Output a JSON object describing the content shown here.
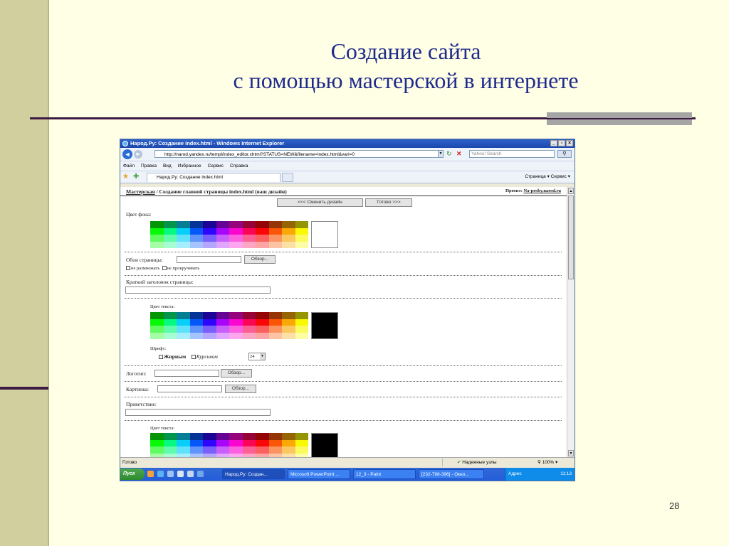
{
  "slide": {
    "title_line1": "Создание сайта",
    "title_line2": "с помощью мастерской в интернете",
    "page_number": "28"
  },
  "browser": {
    "window_title": "Народ.Ру: Создание index.html - Windows Internet Explorer",
    "address": "http://narod.yandex.ru/templ/index_editor.xhtml?STATUS=NEW&filename=index.html&vari=0",
    "search_placeholder": "Yahoo! Search",
    "menu": [
      "Файл",
      "Правка",
      "Вид",
      "Избранное",
      "Сервис",
      "Справка"
    ],
    "tab_title": "Народ.Ру: Создание index.html",
    "command_bar": "Страница ▾  Сервис ▾",
    "status_text": "Готово",
    "zone_text": "Надежные узлы",
    "zoom_text": "100%"
  },
  "page": {
    "breadcrumb_link": "Мастерская",
    "breadcrumb_rest": " / Создание главной страницы index.html (ваш дизайн)",
    "project_label": "Проект: ",
    "project_value": "Na-proby.narod.ru",
    "change_design_button": "<<< Сменить дизайн",
    "done_button": "Готово >>>",
    "bg_color_label": "Цвет фона:",
    "wallpaper_label": "Обои страницы:",
    "browse_label": "Обзор...",
    "no_repeat_label": "не размножать",
    "no_scroll_label": "не прокручивать",
    "short_title_label": "Краткий заголовок страницы:",
    "text_color_label": "Цвет текста:",
    "font_label": "Шрифт:",
    "bold_label": "Жирным",
    "italic_label": "Курсивом",
    "font_size_value": "24",
    "logo_label": "Логотип:",
    "picture_label": "Картинка:",
    "greeting_label": "Приветствие:",
    "text_color_label_2": "Цвет текста:"
  },
  "taskbar": {
    "start_label": "Пуск",
    "tasks": [
      "Народ.Ру: Создан...",
      "Microsoft PowerPoint ...",
      "12_3 - Paint",
      "[232-798-396] - Окно...",
      "Адрес"
    ],
    "clock": "11:13"
  },
  "colors": {
    "slide_bg": "#FFFFE5",
    "side_bar": "#D2CF9F",
    "title_color": "#1F2A8C",
    "rule_dark": "#3D1A42"
  }
}
